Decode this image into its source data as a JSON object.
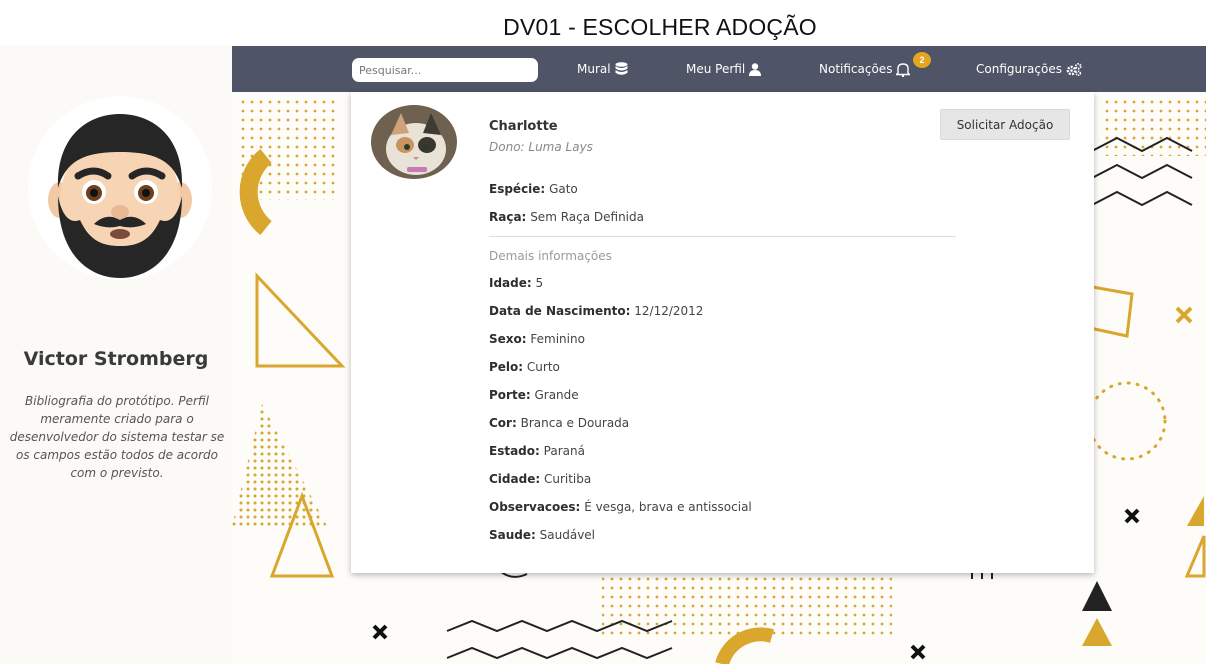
{
  "page": {
    "title": "DV01 - ESCOLHER ADOÇÃO"
  },
  "profile": {
    "name": "Victor Stromberg",
    "bio": "Bibliografia do protótipo. Perfil meramente criado para o desenvolvedor do sistema testar se os campos estão todos de acordo com o previsto."
  },
  "nav": {
    "search_placeholder": "Pesquisar...",
    "mural_label": "Mural",
    "mural_icon": "database-icon",
    "profile_label": "Meu Perfil",
    "profile_icon": "user-icon",
    "notifications_label": "Notificações",
    "notifications_icon": "bell-icon",
    "notifications_count": "2",
    "settings_label": "Configurações",
    "settings_icon": "gears-icon"
  },
  "pet": {
    "name": "Charlotte",
    "owner": "Dono: Luma Lays",
    "adopt_button": "Solicitar Adoção",
    "species_label": "Espécie:",
    "species": "Gato",
    "breed_label": "Raça:",
    "breed": "Sem Raça Definida",
    "more_info_label": "Demais informações",
    "details": [
      {
        "label": "Idade:",
        "value": "5"
      },
      {
        "label": "Data de Nascimento:",
        "value": "12/12/2012"
      },
      {
        "label": "Sexo:",
        "value": "Feminino"
      },
      {
        "label": "Pelo:",
        "value": "Curto"
      },
      {
        "label": "Porte:",
        "value": "Grande"
      },
      {
        "label": "Cor:",
        "value": "Branca e Dourada"
      },
      {
        "label": "Estado:",
        "value": "Paraná"
      },
      {
        "label": "Cidade:",
        "value": "Curitiba"
      },
      {
        "label": "Observacoes:",
        "value": "É vesga, brava e antissocial"
      },
      {
        "label": "Saude:",
        "value": "Saudável"
      }
    ]
  },
  "colors": {
    "navbar": "#4f5466",
    "accent_gold": "#d9a62e",
    "badge": "#e5a51f",
    "sidebar_bg": "#fbfaf6"
  }
}
